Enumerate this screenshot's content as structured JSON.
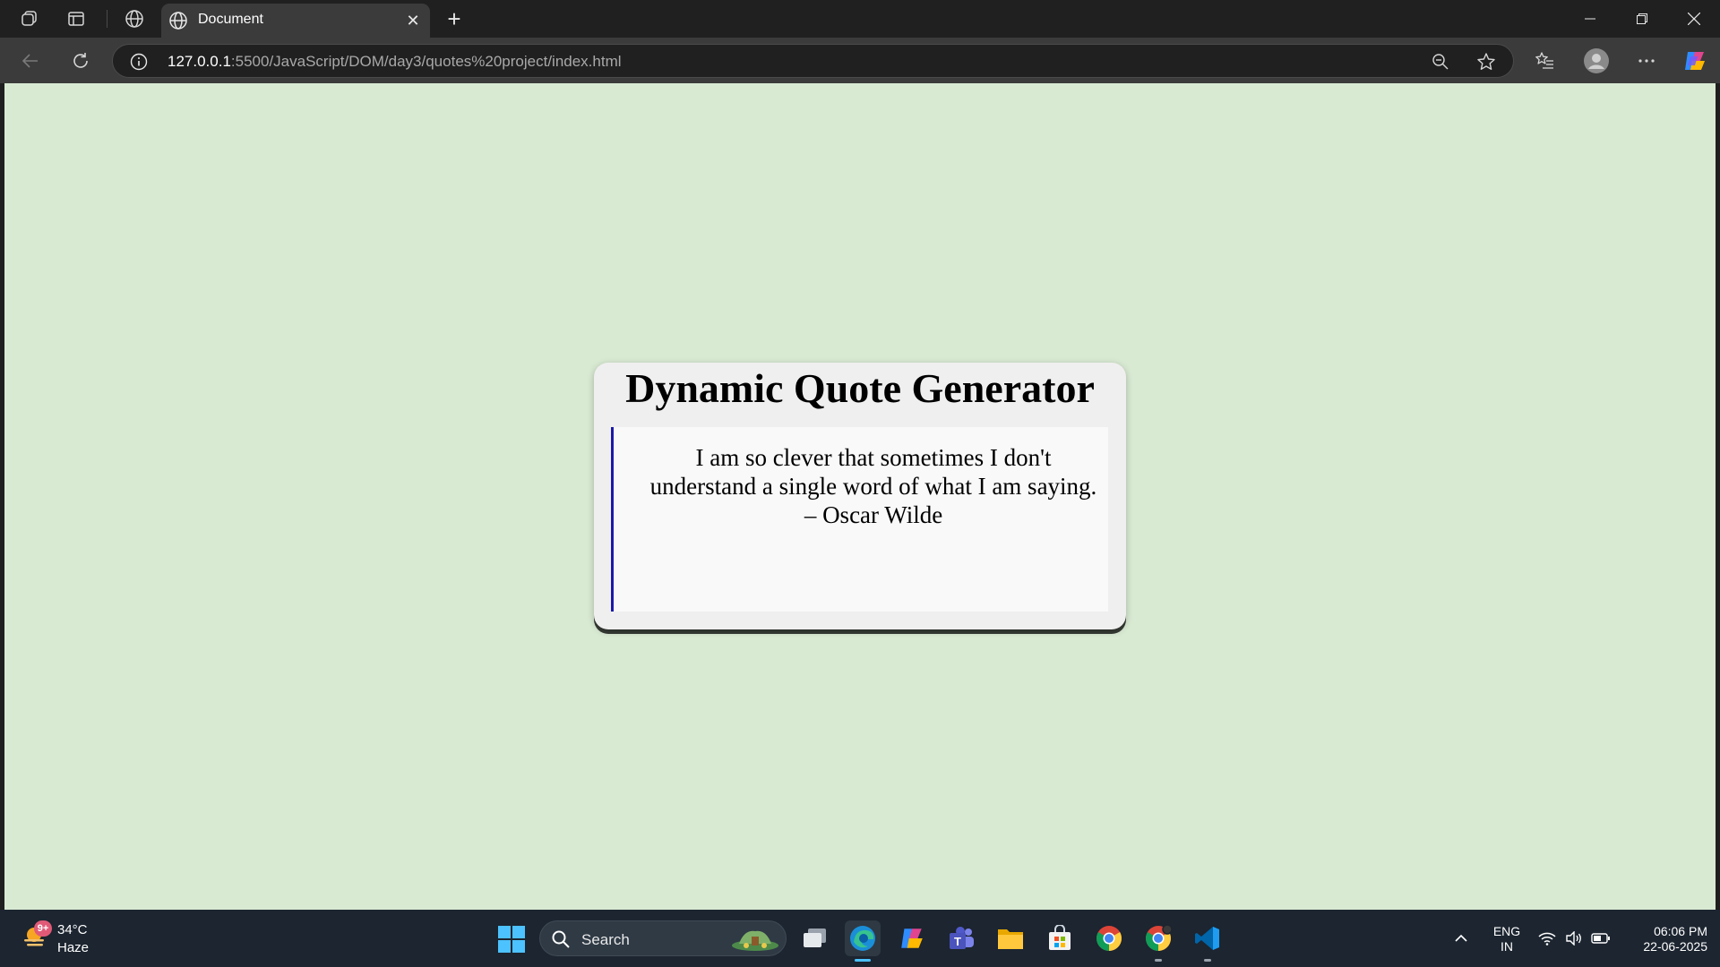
{
  "browser": {
    "tab_title": "Document",
    "url_host": "127.0.0.1",
    "url_rest": ":5500/JavaScript/DOM/day3/quotes%20project/index.html"
  },
  "page": {
    "heading": "Dynamic Quote Generator",
    "quote": "I am so clever that sometimes I don't understand a single word of what I am saying. – Oscar Wilde",
    "background_color": "#d9ead3",
    "quote_border_color": "#1c1aa8"
  },
  "taskbar": {
    "weather_temp": "34°C",
    "weather_condition": "Haze",
    "weather_badge": "9+",
    "search_placeholder": "Search",
    "apps": [
      "task-view",
      "edge",
      "copilot",
      "teams",
      "file-explorer",
      "microsoft-store",
      "chrome",
      "chrome-profile",
      "vscode"
    ],
    "lang_line1": "ENG",
    "lang_line2": "IN",
    "time": "06:06 PM",
    "date": "22-06-2025"
  }
}
